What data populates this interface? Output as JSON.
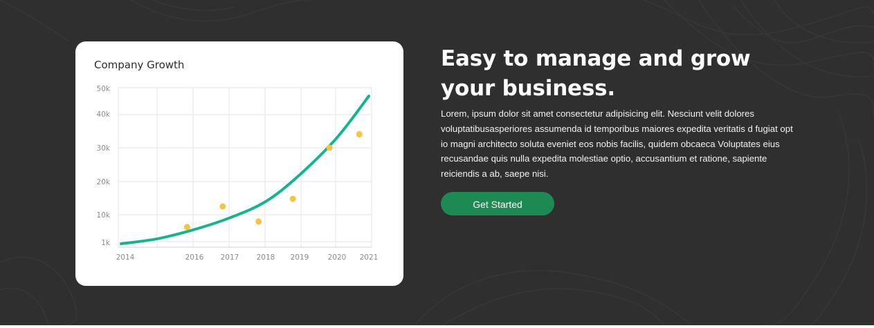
{
  "hero": {
    "headline": "Easy to manage and grow your business.",
    "body": "Lorem, ipsum dolor sit amet consectetur adipisicing elit. Nesciunt velit dolores voluptatibusasperiores assumenda id temporibus maiores expedita veritatis d fugiat opt io magni architecto soluta eveniet eos nobis facilis, quidem obcaeca Voluptates eius recusandae quis nulla expedita molestiae optio, accusantium et ratione, sapiente reiciendis a ab, saepe nisi.",
    "cta_label": "Get Started"
  },
  "colors": {
    "background": "#2f2f2f",
    "card": "#ffffff",
    "curve": "#12b58e",
    "points": "#f6c445",
    "button": "#1e8a53",
    "grid": "#e6e6e6"
  },
  "chart_data": {
    "type": "line",
    "title": "Company Growth",
    "x_ticks": [
      "2014",
      "2016",
      "2017",
      "2018",
      "2019",
      "2020",
      "2021"
    ],
    "y_ticks": [
      "50k",
      "40k",
      "30k",
      "20k",
      "10k",
      "1k"
    ],
    "grid": true,
    "series": [
      {
        "kind": "line",
        "x": [
          2014,
          2015,
          2016,
          2017,
          2018,
          2019,
          2020,
          2021
        ],
        "y": [
          0,
          2200,
          5200,
          9000,
          14000,
          22000,
          33000,
          47000
        ]
      },
      {
        "kind": "scatter",
        "x": [
          2015.8,
          2016.8,
          2017.8,
          2018.8,
          2019.8,
          2020.7
        ],
        "y": [
          6000,
          12500,
          7800,
          14800,
          30000,
          34000
        ]
      }
    ]
  }
}
